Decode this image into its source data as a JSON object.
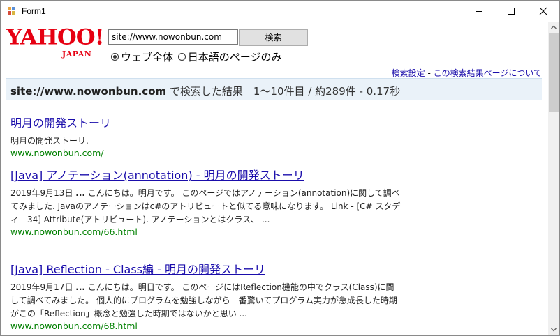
{
  "window": {
    "title": "Form1"
  },
  "search": {
    "logo_main": "YAHOO!",
    "logo_sub": "JAPAN",
    "query": "site://www.nowonbun.com",
    "button_label": "検索",
    "radio_web": "ウェブ全体",
    "radio_japanese": "日本語のページのみ"
  },
  "links": {
    "settings": "検索設定",
    "separator": " - ",
    "about": "この検索結果ページについて"
  },
  "summary": {
    "query": "site://www.nowonbun.com",
    "rest": " で検索した結果　1〜10件目 / 約289件 - 0.17秒"
  },
  "results": [
    {
      "title": "明月の開発ストーリ",
      "snippet": "明月の開発ストーリ.",
      "url": "www.nowonbun.com/"
    },
    {
      "title": "[Java] アノテーション(annotation) - 明月の開発ストーリ",
      "date": "2019年9月13日",
      "snippet_rest": " こんにちは。明月です。 このページではアノテーション(annotation)に関して調べてみました. Javaのアノテーションはc#のアトリビュートと似てる意味になります。 Link - [C# スタディ - 34] Attribute(アトリビュート). アノテーションとはクラス、 ...",
      "url": "www.nowonbun.com/66.html"
    },
    {
      "title": "[Java] Reflection - Class編 - 明月の開発ストーリ",
      "date": "2019年9月17日",
      "snippet_rest": " こんにちは。明日です。 このページにはReflection機能の中でクラス(Class)に関して調べてみました。 個人的にプログラムを勉強しながら一番驚いてプログラム実力が急成長した時期がこの「Reflection」概念と勉強した時期ではないかと思い ...",
      "url": "www.nowonbun.com/68.html"
    }
  ],
  "colors": {
    "link": "#1a0dab",
    "url": "#008000",
    "logo": "#e60012",
    "summary_bg": "#eaf2f9"
  }
}
